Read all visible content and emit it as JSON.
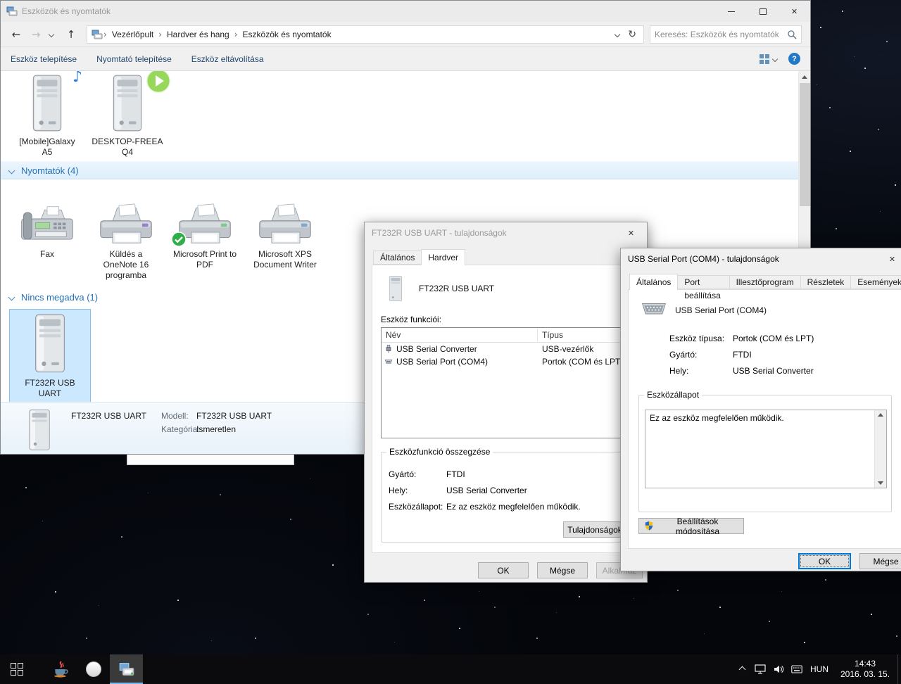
{
  "colors": {
    "accent": "#0078d7",
    "selection_fill": "#cce8ff",
    "selection_border": "#86c1ea",
    "command_text": "#24476f",
    "section_header_text": "#2271b8",
    "default_printer_badge": "#2fae4a",
    "taskbar_background": "#0b0b0e"
  },
  "glyphs": {
    "back_arrow": "←",
    "forward_arrow": "→",
    "up_arrow": "↑",
    "refresh": "↻",
    "breadcrumb_separator": "›",
    "close": "✕",
    "music_note": "♪",
    "help": "?"
  },
  "main_window": {
    "title": "Eszközök és nyomtatók",
    "breadcrumb": {
      "items": [
        "Vezérlőpult",
        "Hardver és hang",
        "Eszközök és nyomtatók"
      ]
    },
    "search": {
      "placeholder": "Keresés: Eszközök és nyomtatók"
    },
    "commands": [
      "Eszköz telepítése",
      "Nyomtató telepítése",
      "Eszköz eltávolítása"
    ],
    "sections": {
      "devices": {
        "items": [
          {
            "label_lines": [
              "[Mobile]Galaxy",
              "A5"
            ]
          },
          {
            "label_lines": [
              "DESKTOP-FREEA",
              "Q4"
            ]
          }
        ]
      },
      "printers": {
        "header": "Nyomtatók (4)",
        "items": [
          {
            "label_lines": [
              "Fax"
            ]
          },
          {
            "label_lines": [
              "Küldés a",
              "OneNote 16",
              "programba"
            ]
          },
          {
            "label_lines": [
              "Microsoft Print to",
              "PDF"
            ]
          },
          {
            "label_lines": [
              "Microsoft XPS",
              "Document Writer"
            ]
          }
        ]
      },
      "unspecified": {
        "header": "Nincs megadva (1)",
        "items": [
          {
            "label_lines": [
              "FT232R USB",
              "UART"
            ]
          }
        ]
      }
    },
    "details_pane": {
      "name": "FT232R USB UART",
      "model_label": "Modell:",
      "model_value": "FT232R USB UART",
      "category_label": "Kategória:",
      "category_value": "Ismeretlen"
    }
  },
  "ft232r_dialog": {
    "title": "FT232R USB UART - tulajdonságok",
    "tabs": [
      "Általános",
      "Hardver"
    ],
    "device_name": "FT232R USB UART",
    "functions_label": "Eszköz funkciói:",
    "list": {
      "col_name": "Név",
      "col_type": "Típus",
      "rows": [
        {
          "name": "USB Serial Converter",
          "type": "USB-vezérlők"
        },
        {
          "name": "USB Serial Port (COM4)",
          "type": "Portok (COM és LPT)"
        }
      ]
    },
    "summary": {
      "title": "Eszközfunkció összegzése",
      "manufacturer_label": "Gyártó:",
      "manufacturer": "FTDI",
      "location_label": "Hely:",
      "location": "USB Serial Converter",
      "status_label": "Eszközállapot:",
      "status": "Ez az eszköz megfelelően működik.",
      "properties_button": "Tulajdonságok"
    },
    "ok": "OK",
    "cancel": "Mégse",
    "apply": "Alkalmaz"
  },
  "com4_dialog": {
    "title": "USB Serial Port (COM4) - tulajdonságok",
    "tabs": [
      "Általános",
      "Port beállítása",
      "Illesztőprogram",
      "Részletek",
      "Események"
    ],
    "device_name": "USB Serial Port (COM4)",
    "device_type_label": "Eszköz típusa:",
    "device_type": "Portok (COM és LPT)",
    "manufacturer_label": "Gyártó:",
    "manufacturer": "FTDI",
    "location_label": "Hely:",
    "location": "USB Serial Converter",
    "status_group": "Eszközállapot",
    "status_text": "Ez az eszköz megfelelően működik.",
    "change_settings_button": "Beállítások módosítása",
    "ok": "OK",
    "cancel": "Mégse"
  },
  "taskbar": {
    "language": "HUN",
    "time": "14:43",
    "date": "2016. 03. 15."
  }
}
